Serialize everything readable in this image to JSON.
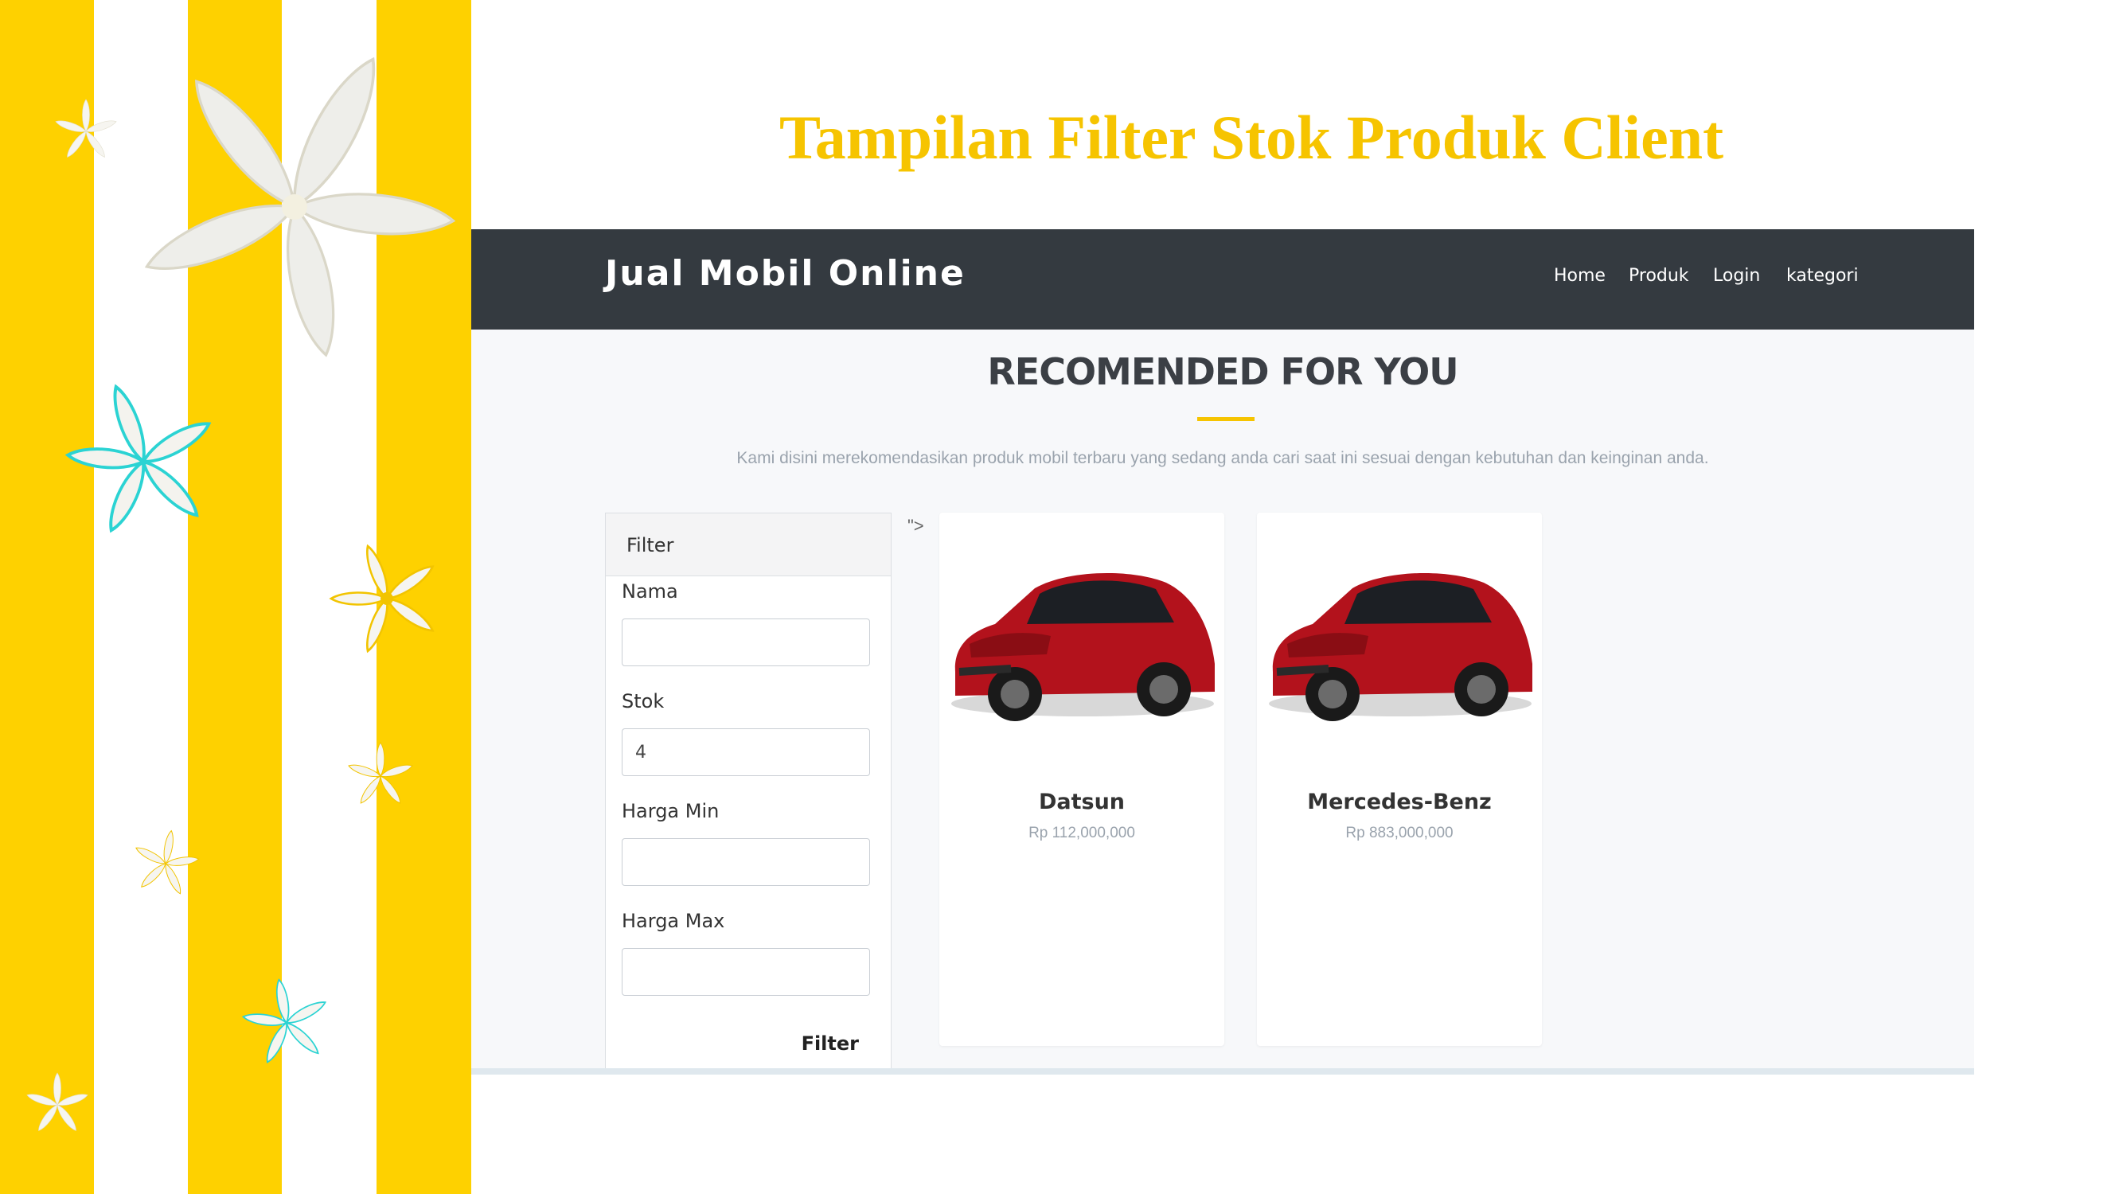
{
  "slide": {
    "title": "Tampilan Filter Stok Produk Client"
  },
  "colors": {
    "accent": "#f6c400",
    "navbar": "#343a40",
    "page_bg": "#f7f8fa",
    "teal": "#2bd3d3"
  },
  "navbar": {
    "brand": "Jual Mobil Online",
    "links": [
      {
        "label": "Home"
      },
      {
        "label": "Produk"
      },
      {
        "label": "Login"
      },
      {
        "label": "kategori"
      }
    ]
  },
  "section": {
    "title": "RECOMENDED FOR YOU",
    "description": "Kami disini merekomendasikan produk mobil terbaru yang sedang anda cari saat ini sesuai dengan kebutuhan dan keinginan anda."
  },
  "filter": {
    "header": "Filter",
    "fields": [
      {
        "label": "Nama",
        "value": ""
      },
      {
        "label": "Stok",
        "value": "4"
      },
      {
        "label": "Harga Min",
        "value": ""
      },
      {
        "label": "Harga Max",
        "value": ""
      }
    ],
    "button": "Filter"
  },
  "stray_text": "\">",
  "products": [
    {
      "name": "Datsun",
      "price": "Rp 112,000,000",
      "image": "red-hatchback-car-image"
    },
    {
      "name": "Mercedes-Benz",
      "price": "Rp 883,000,000",
      "image": "red-hatchback-car-image"
    }
  ],
  "decor_icons": [
    "flower-icon"
  ]
}
